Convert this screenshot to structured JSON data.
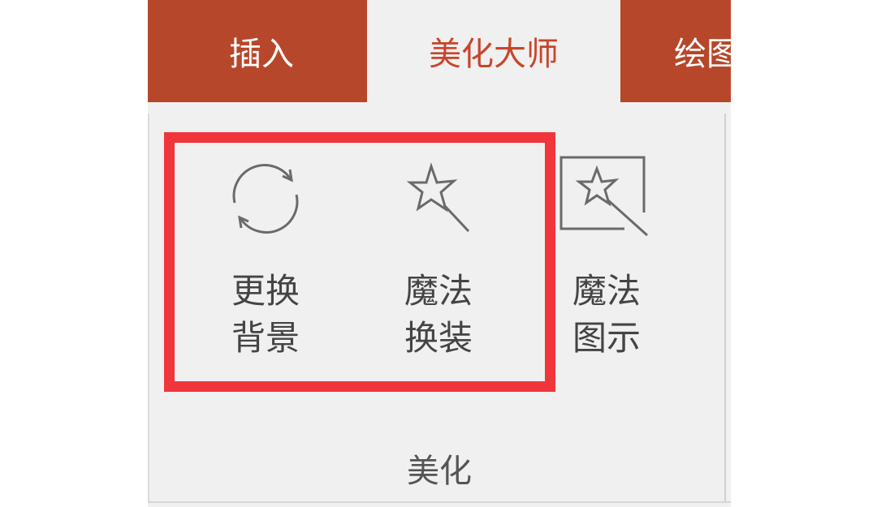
{
  "tabs": [
    {
      "label": "插入"
    },
    {
      "label": "美化大师",
      "active": true
    },
    {
      "label": "绘图"
    }
  ],
  "buttons": [
    {
      "line1": "更换",
      "line2": "背景",
      "icon": "refresh-icon"
    },
    {
      "line1": "魔法",
      "line2": "换装",
      "icon": "magic-wand-icon"
    },
    {
      "line1": "魔法",
      "line2": "图示",
      "icon": "magic-diagram-icon"
    }
  ],
  "group_label": "美化",
  "colors": {
    "tab_bar": "#b7472a",
    "active_tab_text": "#c8452a",
    "highlight_border": "#f0353b",
    "panel_bg": "#f0f0f0"
  }
}
